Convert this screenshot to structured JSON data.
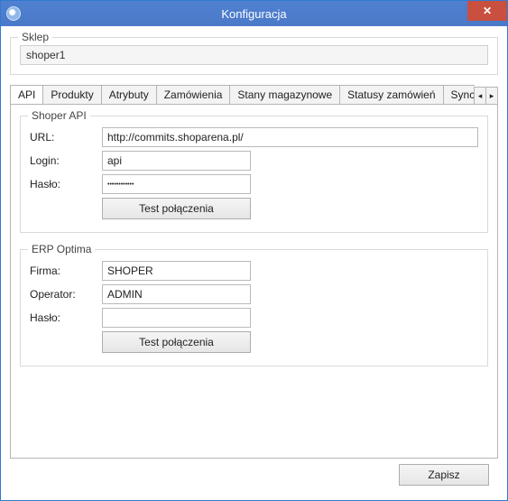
{
  "window": {
    "title": "Konfiguracja",
    "close_symbol": "✕"
  },
  "sklep": {
    "legend": "Sklep",
    "value": "shoper1"
  },
  "tabs": {
    "items": [
      {
        "label": "API",
        "active": true
      },
      {
        "label": "Produkty"
      },
      {
        "label": "Atrybuty"
      },
      {
        "label": "Zamówienia"
      },
      {
        "label": "Stany magazynowe"
      },
      {
        "label": "Statusy zamówień"
      },
      {
        "label": "Synchronizacja a"
      }
    ],
    "scroll_left": "◂",
    "scroll_right": "▸"
  },
  "shoper_api": {
    "legend": "Shoper API",
    "url_label": "URL:",
    "url_value": "http://commits.shoparena.pl/",
    "login_label": "Login:",
    "login_value": "api",
    "haslo_label": "Hasło:",
    "haslo_value": "••••••••••••",
    "test_button": "Test połączenia"
  },
  "erp": {
    "legend": "ERP Optima",
    "firma_label": "Firma:",
    "firma_value": "SHOPER",
    "operator_label": "Operator:",
    "operator_value": "ADMIN",
    "haslo_label": "Hasło:",
    "haslo_value": "",
    "test_button": "Test połączenia"
  },
  "footer": {
    "save_button": "Zapisz"
  }
}
